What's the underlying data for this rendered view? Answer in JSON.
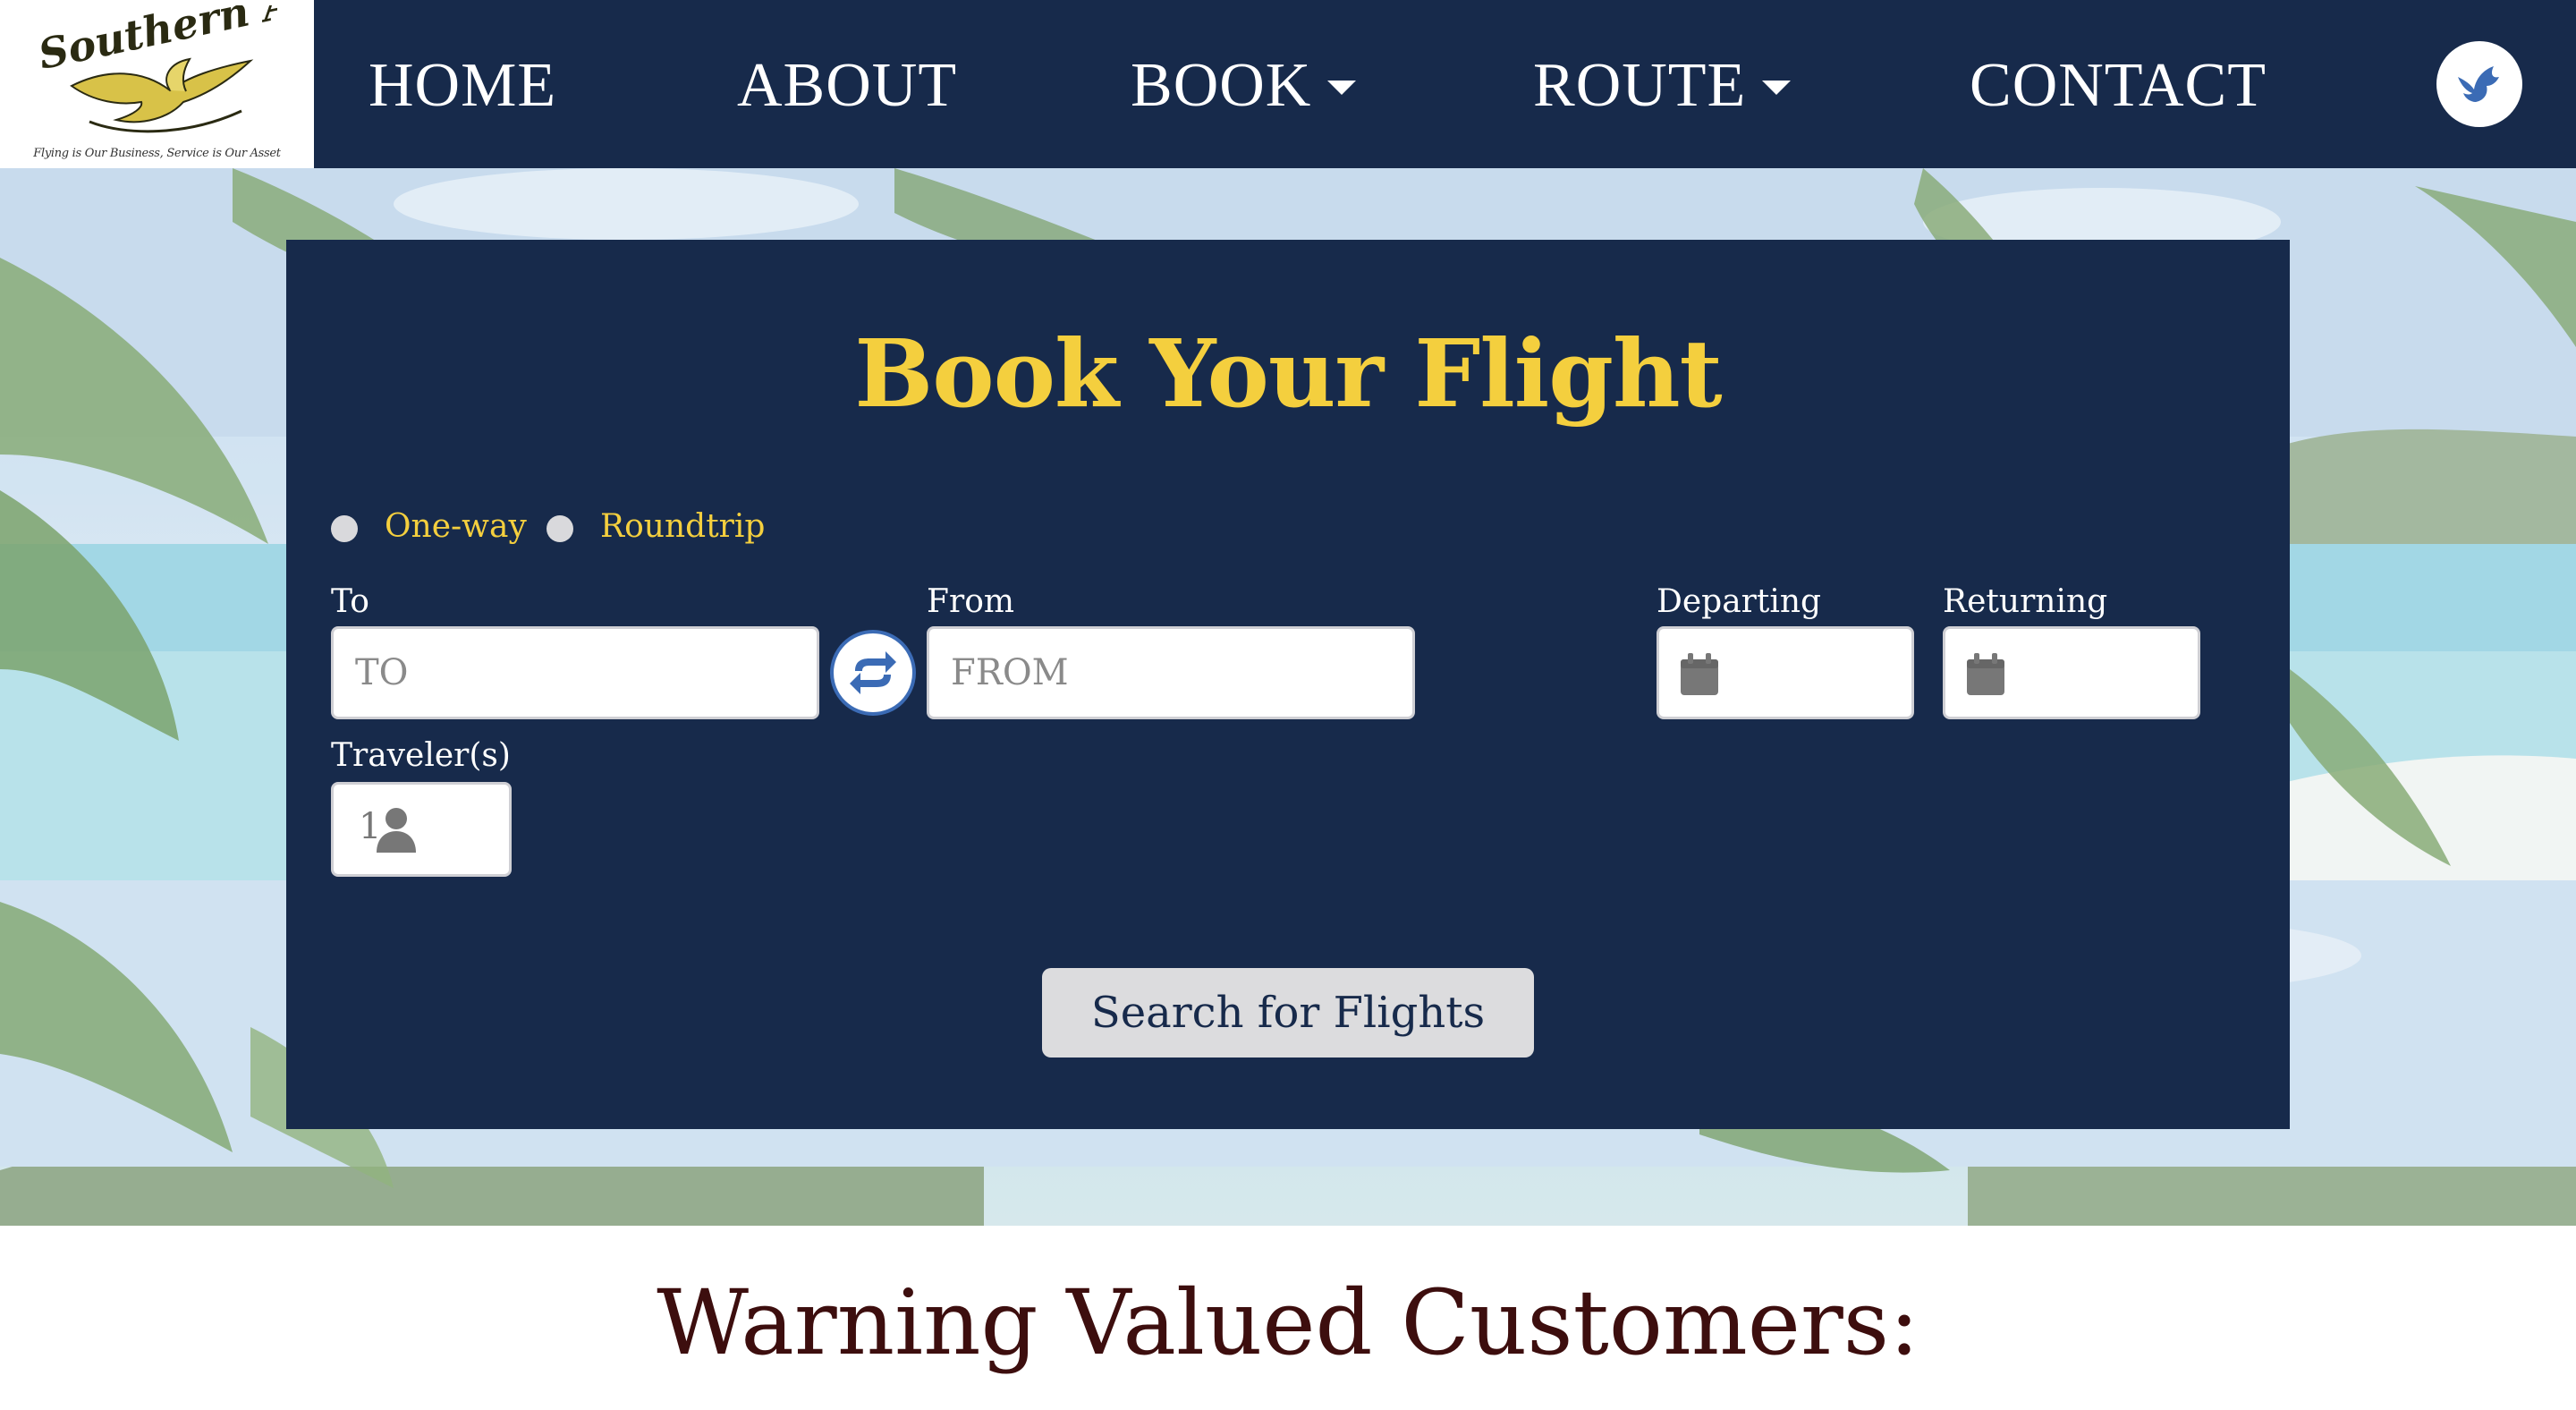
{
  "brand": {
    "logo_text": "Southern Air",
    "tagline": "Flying is Our Business, Service is Our Asset"
  },
  "nav": {
    "items": [
      {
        "label": "HOME"
      },
      {
        "label": "ABOUT"
      },
      {
        "label": "BOOK",
        "dropdown": true
      },
      {
        "label": "ROUTE",
        "dropdown": true
      },
      {
        "label": "CONTACT"
      }
    ],
    "social_icon": "bird-icon"
  },
  "booking": {
    "title": "Book Your Flight",
    "trip_types": [
      "One-way",
      "Roundtrip"
    ],
    "to_label": "To",
    "to_placeholder": "TO",
    "from_label": "From",
    "from_placeholder": "FROM",
    "departing_label": "Departing",
    "returning_label": "Returning",
    "travelers_label": "Traveler(s)",
    "travelers_value": "1",
    "search_label": "Search for Flights"
  },
  "warning": {
    "heading": "Warning Valued Customers:"
  },
  "colors": {
    "navy": "#172a4b",
    "gold": "#f4cf3e",
    "accent_blue": "#3b6bb5",
    "warning_red": "#3d0e0e"
  }
}
